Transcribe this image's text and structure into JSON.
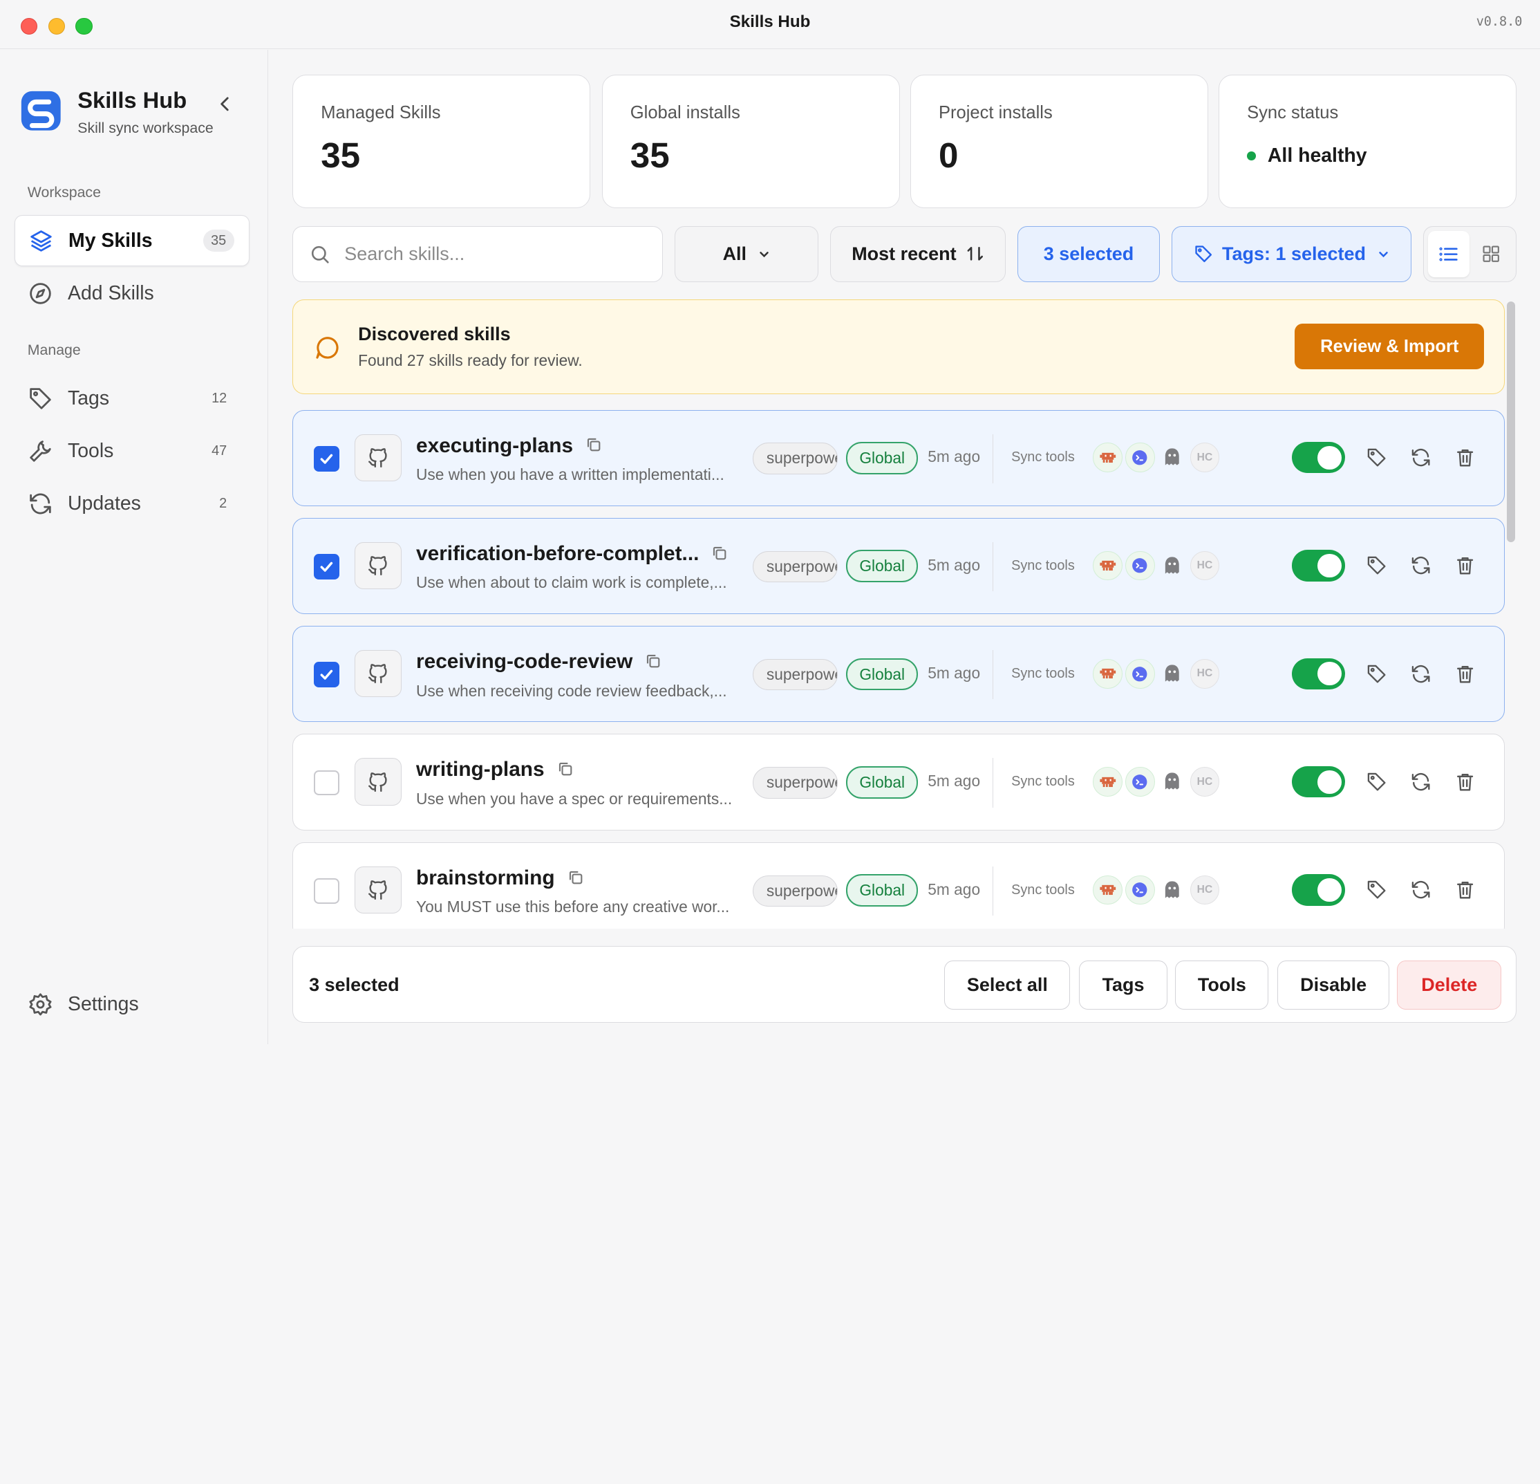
{
  "window": {
    "title": "Skills Hub",
    "version": "v0.8.0"
  },
  "sidebar": {
    "brand_name": "Skills Hub",
    "brand_sub": "Skill sync workspace",
    "workspace_label": "Workspace",
    "manage_label": "Manage",
    "items": [
      {
        "label": "My Skills",
        "count": "35",
        "icon": "layers-icon"
      },
      {
        "label": "Add Skills",
        "count": "",
        "icon": "compass-icon"
      },
      {
        "label": "Tags",
        "count": "12",
        "icon": "tag-icon"
      },
      {
        "label": "Tools",
        "count": "47",
        "icon": "wrench-icon"
      },
      {
        "label": "Updates",
        "count": "2",
        "icon": "refresh-icon"
      }
    ],
    "settings_label": "Settings"
  },
  "stats": [
    {
      "label": "Managed Skills",
      "value": "35"
    },
    {
      "label": "Global installs",
      "value": "35"
    },
    {
      "label": "Project installs",
      "value": "0"
    },
    {
      "label": "Sync status",
      "value": "All healthy"
    }
  ],
  "toolbar": {
    "search_placeholder": "Search skills...",
    "filter": "All",
    "sort": "Most recent",
    "selected": "3 selected",
    "tags": "Tags: 1 selected"
  },
  "banner": {
    "title": "Discovered skills",
    "subtitle": "Found 27 skills ready for review.",
    "button": "Review & Import"
  },
  "skills": [
    {
      "name": "executing-plans",
      "desc": "Use when you have a written implementati...",
      "source": "superpowers",
      "scope": "Global",
      "time": "5m ago",
      "sync_label": "Sync tools",
      "selected": true,
      "enabled": true
    },
    {
      "name": "verification-before-complet...",
      "desc": "Use when about to claim work is complete,...",
      "source": "superpowers",
      "scope": "Global",
      "time": "5m ago",
      "sync_label": "Sync tools",
      "selected": true,
      "enabled": true
    },
    {
      "name": "receiving-code-review",
      "desc": "Use when receiving code review feedback,...",
      "source": "superpowers",
      "scope": "Global",
      "time": "5m ago",
      "sync_label": "Sync tools",
      "selected": true,
      "enabled": true
    },
    {
      "name": "writing-plans",
      "desc": "Use when you have a spec or requirements...",
      "source": "superpowers",
      "scope": "Global",
      "time": "5m ago",
      "sync_label": "Sync tools",
      "selected": false,
      "enabled": true
    },
    {
      "name": "brainstorming",
      "desc": "You MUST use this before any creative wor...",
      "source": "superpowers",
      "scope": "Global",
      "time": "5m ago",
      "sync_label": "Sync tools",
      "selected": false,
      "enabled": true
    }
  ],
  "tool_badge_hc": "HC",
  "bottom": {
    "label": "3 selected",
    "select_all": "Select all",
    "tags": "Tags",
    "tools": "Tools",
    "disable": "Disable",
    "delete": "Delete"
  },
  "colors": {
    "accent": "#2563eb",
    "success": "#16a34a",
    "warning": "#d97706",
    "danger": "#dc2626"
  }
}
